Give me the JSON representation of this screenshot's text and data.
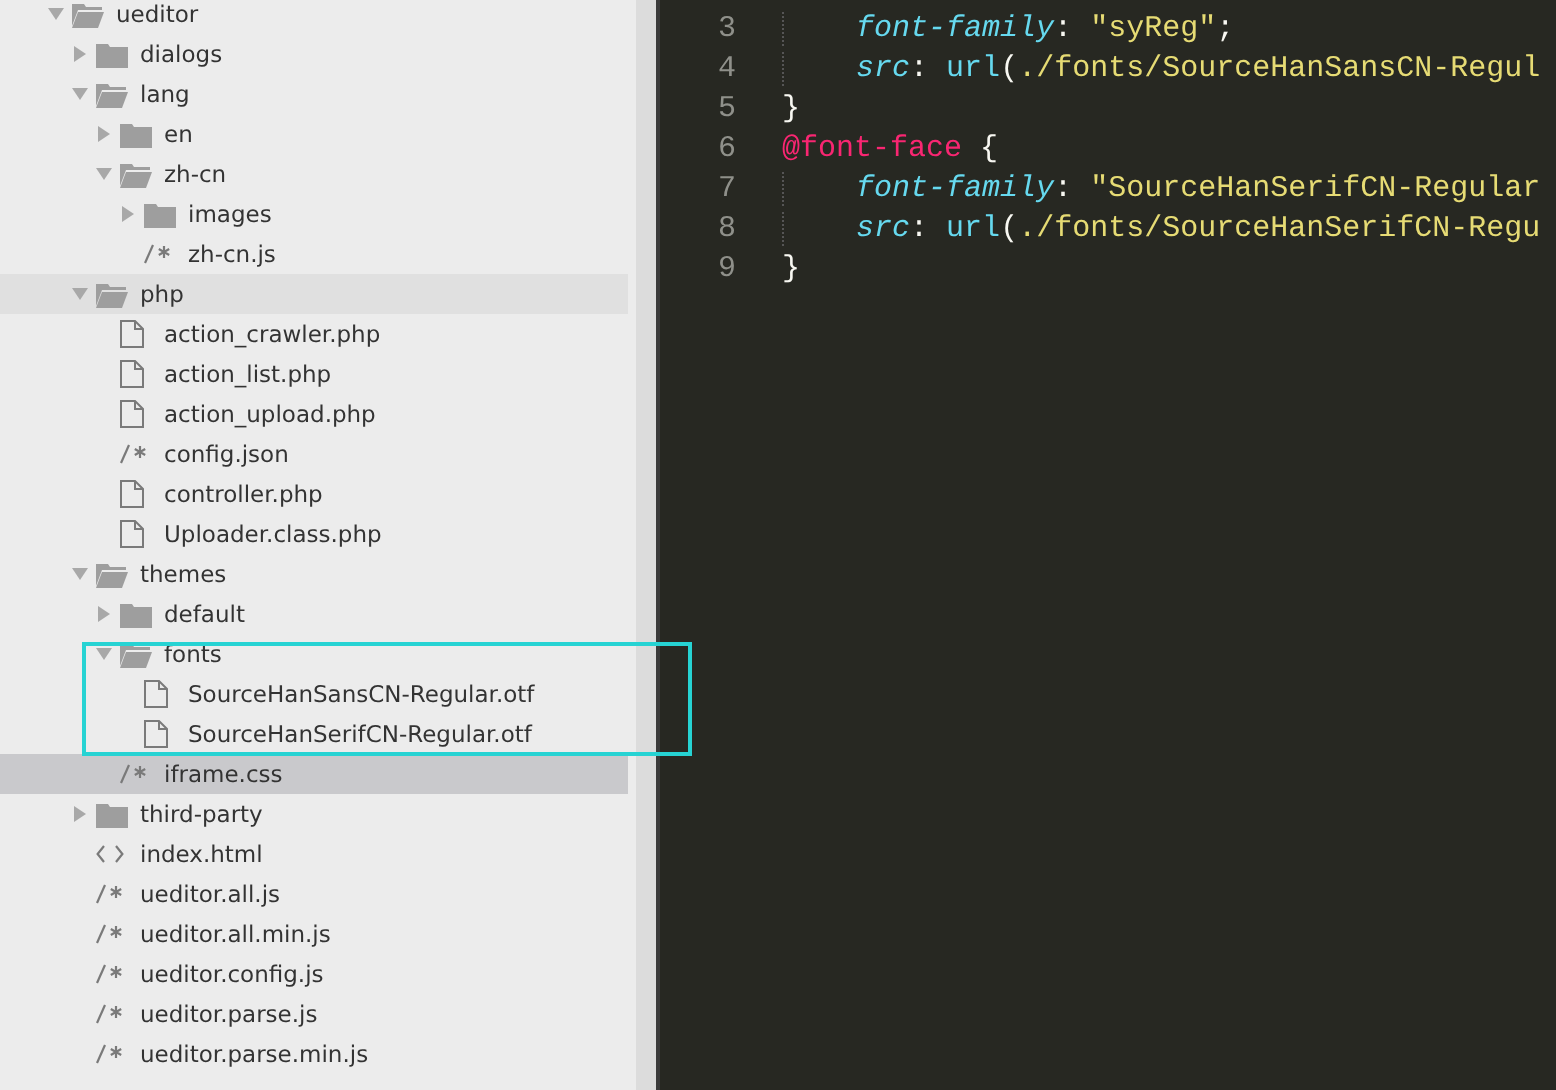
{
  "sidebar": {
    "tree": [
      {
        "label": "ueditor",
        "kind": "folder",
        "expanded": true,
        "selected": false,
        "hovered": false,
        "children": [
          {
            "label": "dialogs",
            "kind": "folder",
            "expanded": false,
            "selected": false,
            "hovered": false
          },
          {
            "label": "lang",
            "kind": "folder",
            "expanded": true,
            "selected": false,
            "hovered": false,
            "children": [
              {
                "label": "en",
                "kind": "folder",
                "expanded": false,
                "selected": false,
                "hovered": false
              },
              {
                "label": "zh-cn",
                "kind": "folder",
                "expanded": true,
                "selected": false,
                "hovered": false,
                "children": [
                  {
                    "label": "images",
                    "kind": "folder",
                    "expanded": false,
                    "selected": false,
                    "hovered": false
                  },
                  {
                    "label": "zh-cn.js",
                    "kind": "script",
                    "selected": false,
                    "hovered": false
                  }
                ]
              }
            ]
          },
          {
            "label": "php",
            "kind": "folder",
            "expanded": true,
            "selected": false,
            "hovered": true,
            "children": [
              {
                "label": "action_crawler.php",
                "kind": "file",
                "selected": false,
                "hovered": false
              },
              {
                "label": "action_list.php",
                "kind": "file",
                "selected": false,
                "hovered": false
              },
              {
                "label": "action_upload.php",
                "kind": "file",
                "selected": false,
                "hovered": false
              },
              {
                "label": "config.json",
                "kind": "script",
                "selected": false,
                "hovered": false
              },
              {
                "label": "controller.php",
                "kind": "file",
                "selected": false,
                "hovered": false
              },
              {
                "label": "Uploader.class.php",
                "kind": "file",
                "selected": false,
                "hovered": false
              }
            ]
          },
          {
            "label": "themes",
            "kind": "folder",
            "expanded": true,
            "selected": false,
            "hovered": false,
            "children": [
              {
                "label": "default",
                "kind": "folder",
                "expanded": false,
                "selected": false,
                "hovered": false
              },
              {
                "label": "fonts",
                "kind": "folder",
                "expanded": true,
                "selected": false,
                "hovered": false,
                "children": [
                  {
                    "label": "SourceHanSansCN-Regular.otf",
                    "kind": "file",
                    "selected": false,
                    "hovered": false
                  },
                  {
                    "label": "SourceHanSerifCN-Regular.otf",
                    "kind": "file",
                    "selected": false,
                    "hovered": false
                  }
                ]
              },
              {
                "label": "iframe.css",
                "kind": "script",
                "selected": true,
                "hovered": false
              }
            ]
          },
          {
            "label": "third-party",
            "kind": "folder",
            "expanded": false,
            "selected": false,
            "hovered": false
          },
          {
            "label": "index.html",
            "kind": "html",
            "selected": false,
            "hovered": false
          },
          {
            "label": "ueditor.all.js",
            "kind": "script",
            "selected": false,
            "hovered": false
          },
          {
            "label": "ueditor.all.min.js",
            "kind": "script",
            "selected": false,
            "hovered": false
          },
          {
            "label": "ueditor.config.js",
            "kind": "script",
            "selected": false,
            "hovered": false
          },
          {
            "label": "ueditor.parse.js",
            "kind": "script",
            "selected": false,
            "hovered": false
          },
          {
            "label": "ueditor.parse.min.js",
            "kind": "script",
            "selected": false,
            "hovered": false
          }
        ]
      }
    ]
  },
  "editor": {
    "lines": [
      {
        "number": "3",
        "indent": true,
        "tokens": [
          {
            "kind": "property",
            "text": "font-family"
          },
          {
            "kind": "punct",
            "text": ": "
          },
          {
            "kind": "string",
            "text": "\"syReg\""
          },
          {
            "kind": "punct",
            "text": ";"
          }
        ]
      },
      {
        "number": "4",
        "indent": true,
        "tokens": [
          {
            "kind": "property",
            "text": "src"
          },
          {
            "kind": "punct",
            "text": ": "
          },
          {
            "kind": "function",
            "text": "url"
          },
          {
            "kind": "punct",
            "text": "("
          },
          {
            "kind": "string",
            "text": "./fonts/SourceHanSansCN-Regul"
          }
        ]
      },
      {
        "number": "5",
        "indent": false,
        "tokens": [
          {
            "kind": "punct",
            "text": "}"
          }
        ]
      },
      {
        "number": "6",
        "indent": false,
        "tokens": [
          {
            "kind": "at-rule",
            "text": "@font-face"
          },
          {
            "kind": "punct",
            "text": " {"
          }
        ]
      },
      {
        "number": "7",
        "indent": true,
        "tokens": [
          {
            "kind": "property",
            "text": "font-family"
          },
          {
            "kind": "punct",
            "text": ": "
          },
          {
            "kind": "string",
            "text": "\"SourceHanSerifCN-Regular"
          }
        ]
      },
      {
        "number": "8",
        "indent": true,
        "tokens": [
          {
            "kind": "property",
            "text": "src"
          },
          {
            "kind": "punct",
            "text": ": "
          },
          {
            "kind": "function",
            "text": "url"
          },
          {
            "kind": "punct",
            "text": "("
          },
          {
            "kind": "string",
            "text": "./fonts/SourceHanSerifCN-Regu"
          }
        ]
      },
      {
        "number": "9",
        "indent": false,
        "tokens": [
          {
            "kind": "punct",
            "text": "}"
          }
        ]
      }
    ]
  }
}
